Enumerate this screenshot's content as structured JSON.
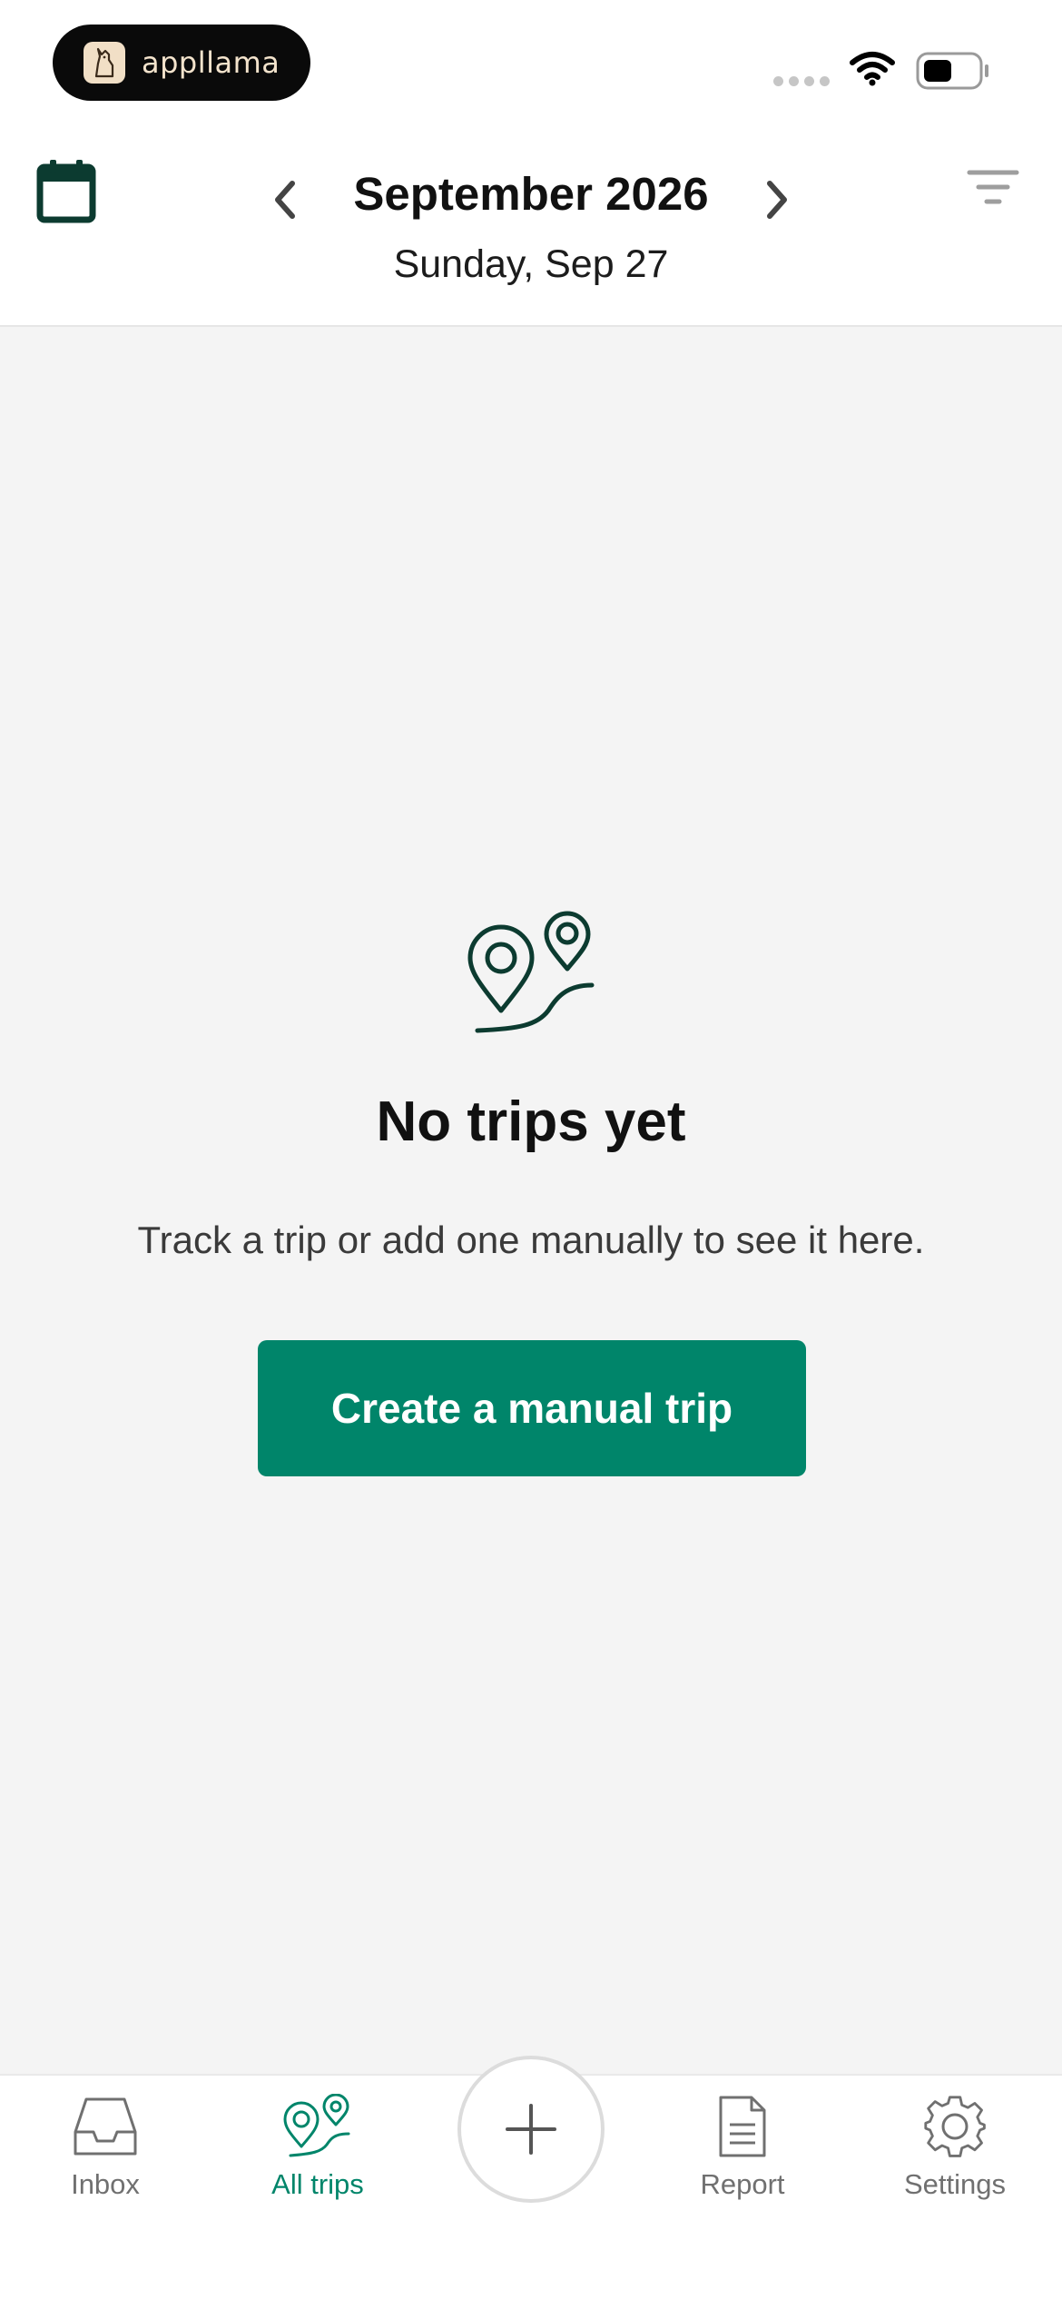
{
  "status_bar": {
    "brand_name": "appllama",
    "icons": [
      "llama-logo-icon",
      "signal-dots-icon",
      "wifi-icon",
      "battery-icon"
    ]
  },
  "header": {
    "month_title": "September 2026",
    "day_subtitle": "Sunday, Sep 27",
    "icons": {
      "calendar": "calendar-icon",
      "previous": "chevron-left-icon",
      "next": "chevron-right-icon",
      "filter": "filter-icon"
    }
  },
  "empty_state": {
    "icon": "map-pins-route-icon",
    "title": "No trips yet",
    "message": "Track a trip or add one manually to see it here.",
    "button_label": "Create a manual trip"
  },
  "tab_bar": {
    "tabs": [
      {
        "label": "Inbox",
        "icon": "inbox-icon",
        "active": false
      },
      {
        "label": "All trips",
        "icon": "map-pins-icon",
        "active": true
      },
      {
        "label": "Report",
        "icon": "document-icon",
        "active": false
      },
      {
        "label": "Settings",
        "icon": "gear-icon",
        "active": false
      }
    ],
    "fab_icon": "plus-icon"
  },
  "colors": {
    "accent": "#00856a",
    "icon_dark": "#0c3b30",
    "background": "#f4f4f4",
    "inactive": "#707070"
  }
}
